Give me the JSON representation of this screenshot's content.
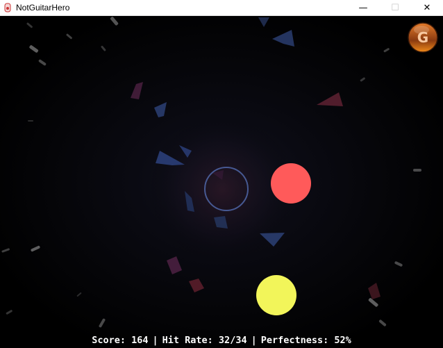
{
  "window": {
    "title": "NotGuitarHero",
    "controls": [
      "—",
      "☐",
      "✕"
    ],
    "icons": {
      "app": "guitar-app-icon",
      "minimize": "minimize-icon",
      "maximize": "maximize-icon",
      "close": "close-icon"
    }
  },
  "game": {
    "logo_letter": "G",
    "target_ring_color": "#4a5e9a",
    "notes": [
      {
        "color": "#ff5a5a",
        "lane": "right"
      },
      {
        "color": "#f2f55a",
        "lane": "bottom"
      }
    ],
    "hud": {
      "score_label": "Score: 164",
      "hit_rate_label": "Hit Rate: 32/34",
      "perfectness_label": "Perfectness: 52%",
      "separator": "|"
    }
  }
}
